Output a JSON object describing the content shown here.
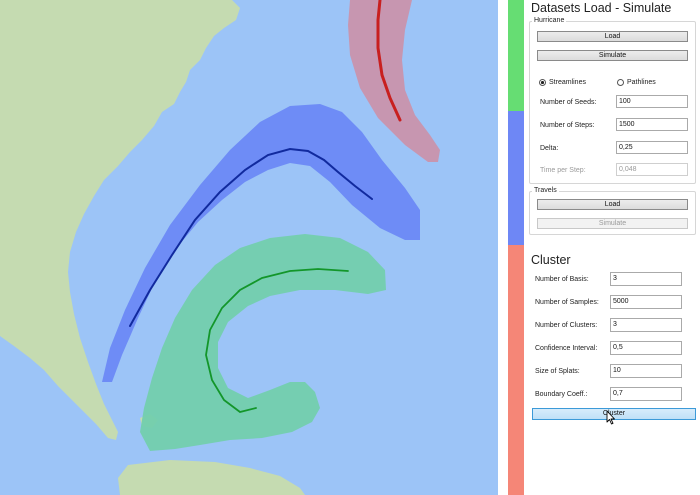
{
  "map": {
    "colors": {
      "ocean": "#9cc4f7",
      "land": "#c5dbb1",
      "red_band": "#c994ac",
      "red_track": "#c81f1f",
      "blue_band": "#6b89f5",
      "blue_track": "#112a9e",
      "green_band": "#73cfad",
      "green_track": "#13962a"
    }
  },
  "stripes": {
    "green": "#66dd73",
    "blue": "#6e87f5",
    "red": "#f58677"
  },
  "panel": {
    "title": "Datasets Load - Simulate",
    "hurricane": {
      "group_label": "Hurricane",
      "load_label": "Load",
      "simulate_label": "Simulate",
      "streamlines_label": "Streamlines",
      "pathlines_label": "Pathlines",
      "selected": "Streamlines",
      "seeds_label": "Number of Seeds:",
      "seeds_value": "100",
      "steps_label": "Number of Steps:",
      "steps_value": "1500",
      "delta_label": "Delta:",
      "delta_value": "0,25",
      "time_label": "Time per Step:",
      "time_value": "0,048"
    },
    "travels": {
      "group_label": "Travels",
      "load_label": "Load",
      "simulate_label": "Simulate"
    },
    "cluster": {
      "title": "Cluster",
      "basis_label": "Number of Basis:",
      "basis_value": "3",
      "samples_label": "Number of Samples:",
      "samples_value": "5000",
      "clusters_label": "Number of Clusters:",
      "clusters_value": "3",
      "confidence_label": "Confidence Interval:",
      "confidence_value": "0,5",
      "splats_label": "Size of Splats:",
      "splats_value": "10",
      "boundary_label": "Boundary Coeff.:",
      "boundary_value": "0,7",
      "cluster_button_label": "Cluster"
    }
  }
}
